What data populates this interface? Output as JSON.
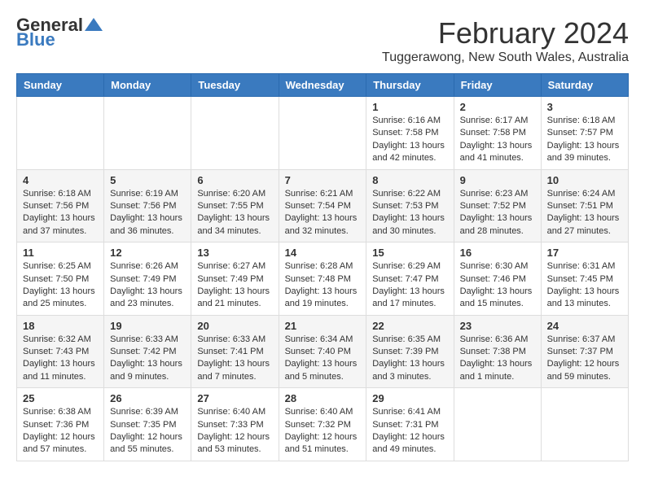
{
  "logo": {
    "general": "General",
    "blue": "Blue"
  },
  "title": "February 2024",
  "subtitle": "Tuggerawong, New South Wales, Australia",
  "days_of_week": [
    "Sunday",
    "Monday",
    "Tuesday",
    "Wednesday",
    "Thursday",
    "Friday",
    "Saturday"
  ],
  "weeks": [
    [
      {
        "day": "",
        "info": ""
      },
      {
        "day": "",
        "info": ""
      },
      {
        "day": "",
        "info": ""
      },
      {
        "day": "",
        "info": ""
      },
      {
        "day": "1",
        "info": "Sunrise: 6:16 AM\nSunset: 7:58 PM\nDaylight: 13 hours\nand 42 minutes."
      },
      {
        "day": "2",
        "info": "Sunrise: 6:17 AM\nSunset: 7:58 PM\nDaylight: 13 hours\nand 41 minutes."
      },
      {
        "day": "3",
        "info": "Sunrise: 6:18 AM\nSunset: 7:57 PM\nDaylight: 13 hours\nand 39 minutes."
      }
    ],
    [
      {
        "day": "4",
        "info": "Sunrise: 6:18 AM\nSunset: 7:56 PM\nDaylight: 13 hours\nand 37 minutes."
      },
      {
        "day": "5",
        "info": "Sunrise: 6:19 AM\nSunset: 7:56 PM\nDaylight: 13 hours\nand 36 minutes."
      },
      {
        "day": "6",
        "info": "Sunrise: 6:20 AM\nSunset: 7:55 PM\nDaylight: 13 hours\nand 34 minutes."
      },
      {
        "day": "7",
        "info": "Sunrise: 6:21 AM\nSunset: 7:54 PM\nDaylight: 13 hours\nand 32 minutes."
      },
      {
        "day": "8",
        "info": "Sunrise: 6:22 AM\nSunset: 7:53 PM\nDaylight: 13 hours\nand 30 minutes."
      },
      {
        "day": "9",
        "info": "Sunrise: 6:23 AM\nSunset: 7:52 PM\nDaylight: 13 hours\nand 28 minutes."
      },
      {
        "day": "10",
        "info": "Sunrise: 6:24 AM\nSunset: 7:51 PM\nDaylight: 13 hours\nand 27 minutes."
      }
    ],
    [
      {
        "day": "11",
        "info": "Sunrise: 6:25 AM\nSunset: 7:50 PM\nDaylight: 13 hours\nand 25 minutes."
      },
      {
        "day": "12",
        "info": "Sunrise: 6:26 AM\nSunset: 7:49 PM\nDaylight: 13 hours\nand 23 minutes."
      },
      {
        "day": "13",
        "info": "Sunrise: 6:27 AM\nSunset: 7:49 PM\nDaylight: 13 hours\nand 21 minutes."
      },
      {
        "day": "14",
        "info": "Sunrise: 6:28 AM\nSunset: 7:48 PM\nDaylight: 13 hours\nand 19 minutes."
      },
      {
        "day": "15",
        "info": "Sunrise: 6:29 AM\nSunset: 7:47 PM\nDaylight: 13 hours\nand 17 minutes."
      },
      {
        "day": "16",
        "info": "Sunrise: 6:30 AM\nSunset: 7:46 PM\nDaylight: 13 hours\nand 15 minutes."
      },
      {
        "day": "17",
        "info": "Sunrise: 6:31 AM\nSunset: 7:45 PM\nDaylight: 13 hours\nand 13 minutes."
      }
    ],
    [
      {
        "day": "18",
        "info": "Sunrise: 6:32 AM\nSunset: 7:43 PM\nDaylight: 13 hours\nand 11 minutes."
      },
      {
        "day": "19",
        "info": "Sunrise: 6:33 AM\nSunset: 7:42 PM\nDaylight: 13 hours\nand 9 minutes."
      },
      {
        "day": "20",
        "info": "Sunrise: 6:33 AM\nSunset: 7:41 PM\nDaylight: 13 hours\nand 7 minutes."
      },
      {
        "day": "21",
        "info": "Sunrise: 6:34 AM\nSunset: 7:40 PM\nDaylight: 13 hours\nand 5 minutes."
      },
      {
        "day": "22",
        "info": "Sunrise: 6:35 AM\nSunset: 7:39 PM\nDaylight: 13 hours\nand 3 minutes."
      },
      {
        "day": "23",
        "info": "Sunrise: 6:36 AM\nSunset: 7:38 PM\nDaylight: 13 hours\nand 1 minute."
      },
      {
        "day": "24",
        "info": "Sunrise: 6:37 AM\nSunset: 7:37 PM\nDaylight: 12 hours\nand 59 minutes."
      }
    ],
    [
      {
        "day": "25",
        "info": "Sunrise: 6:38 AM\nSunset: 7:36 PM\nDaylight: 12 hours\nand 57 minutes."
      },
      {
        "day": "26",
        "info": "Sunrise: 6:39 AM\nSunset: 7:35 PM\nDaylight: 12 hours\nand 55 minutes."
      },
      {
        "day": "27",
        "info": "Sunrise: 6:40 AM\nSunset: 7:33 PM\nDaylight: 12 hours\nand 53 minutes."
      },
      {
        "day": "28",
        "info": "Sunrise: 6:40 AM\nSunset: 7:32 PM\nDaylight: 12 hours\nand 51 minutes."
      },
      {
        "day": "29",
        "info": "Sunrise: 6:41 AM\nSunset: 7:31 PM\nDaylight: 12 hours\nand 49 minutes."
      },
      {
        "day": "",
        "info": ""
      },
      {
        "day": "",
        "info": ""
      }
    ]
  ]
}
